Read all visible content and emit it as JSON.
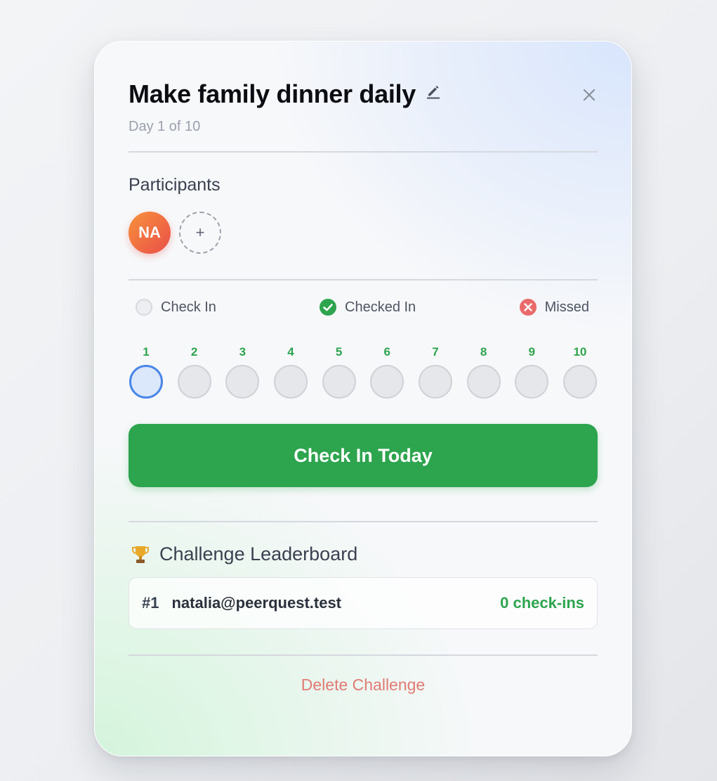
{
  "challenge": {
    "title": "Make family dinner daily",
    "subtitle": "Day 1 of 10"
  },
  "participants": {
    "label": "Participants",
    "members": [
      {
        "initials": "NA"
      }
    ],
    "add_label": "+"
  },
  "legend": {
    "check_in": "Check In",
    "checked_in": "Checked In",
    "missed": "Missed"
  },
  "days": [
    "1",
    "2",
    "3",
    "4",
    "5",
    "6",
    "7",
    "8",
    "9",
    "10"
  ],
  "checkin_button": "Check In Today",
  "leaderboard": {
    "title": "Challenge Leaderboard",
    "entries": [
      {
        "rank": "#1",
        "email": "natalia@peerquest.test",
        "count": "0 check-ins"
      }
    ]
  },
  "delete_label": "Delete Challenge",
  "colors": {
    "accent_green": "#2da44e",
    "today_blue": "#4a86e8",
    "missed_red": "#ea6a6a",
    "delete_red": "#e07b74"
  },
  "icons": {
    "edit": "pencil-icon",
    "close": "close-icon",
    "checked": "check-circle-icon",
    "missed": "x-circle-icon",
    "trophy": "trophy-icon"
  }
}
